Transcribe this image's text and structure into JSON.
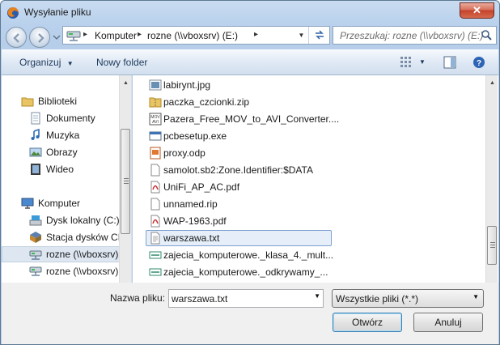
{
  "window": {
    "title": "Wysyłanie pliku",
    "close_glyph": "✕"
  },
  "address_bar": {
    "breadcrumbs": [
      "Komputer",
      "rozne (\\\\vboxsrv) (E:)"
    ],
    "separator_glyph": "▸"
  },
  "search": {
    "placeholder": "Przeszukaj: rozne (\\\\vboxsrv) (E:)"
  },
  "commands": {
    "organize": "Organizuj",
    "new_folder": "Nowy folder",
    "dropdown_glyph": "▼"
  },
  "nav_tree": {
    "items": [
      {
        "label": "Biblioteki",
        "icon": "library-icon"
      },
      {
        "label": "Dokumenty",
        "icon": "documents-icon"
      },
      {
        "label": "Muzyka",
        "icon": "music-icon"
      },
      {
        "label": "Obrazy",
        "icon": "pictures-icon"
      },
      {
        "label": "Wideo",
        "icon": "video-icon"
      },
      {
        "label": "Komputer",
        "icon": "computer-icon"
      },
      {
        "label": "Dysk lokalny (C:)",
        "icon": "local-disk-icon"
      },
      {
        "label": "Stacja dysków CD",
        "icon": "cd-drive-icon"
      },
      {
        "label": "rozne (\\\\vboxsrv)",
        "icon": "network-drive-icon",
        "selected": true
      },
      {
        "label": "rozne (\\\\vboxsrv)",
        "icon": "network-drive-icon"
      }
    ]
  },
  "files": [
    {
      "name": "labirynt.jpg",
      "icon": "image-file-icon"
    },
    {
      "name": "paczka_czcionki.zip",
      "icon": "zip-file-icon"
    },
    {
      "name": "Pazera_Free_MOV_to_AVI_Converter....",
      "icon": "video-app-icon"
    },
    {
      "name": "pcbesetup.exe",
      "icon": "exe-file-icon"
    },
    {
      "name": "proxy.odp",
      "icon": "presentation-file-icon"
    },
    {
      "name": "samolot.sb2:Zone.Identifier:$DATA",
      "icon": "blank-file-icon"
    },
    {
      "name": "UniFi_AP_AC.pdf",
      "icon": "pdf-file-icon"
    },
    {
      "name": "unnamed.rip",
      "icon": "blank-file-icon"
    },
    {
      "name": "WAP-1963.pdf",
      "icon": "pdf-file-icon"
    },
    {
      "name": "warszawa.txt",
      "icon": "text-file-icon",
      "selected": true
    },
    {
      "name": "zajecia_komputerowe._klasa_4._mult...",
      "icon": "shortcut-file-icon"
    },
    {
      "name": "zajecia_komputerowe._odkrywamy_...",
      "icon": "shortcut-file-icon"
    }
  ],
  "footer": {
    "file_name_label": "Nazwa pliku:",
    "file_name_value": "warszawa.txt",
    "file_type": "Wszystkie pliki (*.*)",
    "open_button": "Otwórz",
    "cancel_button": "Anuluj"
  },
  "colors": {
    "selection_border": "#7da2ce",
    "close_button": "#c2422a",
    "chrome": "#b9d1ec"
  }
}
